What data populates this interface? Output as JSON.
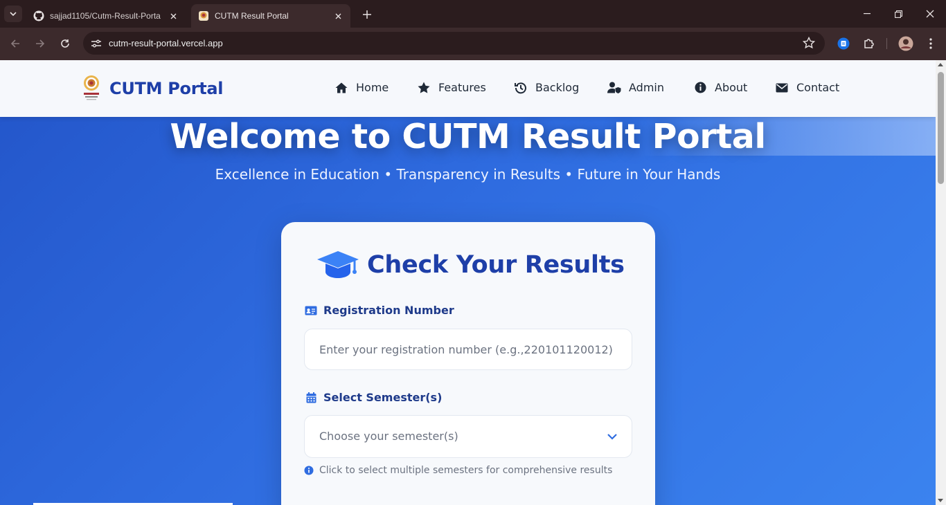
{
  "browser": {
    "tabs": [
      {
        "title": "sajjad1105/Cutm-Result-Portal",
        "icon": "github-icon",
        "active": false
      },
      {
        "title": "CUTM Result Portal",
        "icon": "cutm-favicon",
        "active": true
      }
    ],
    "url": "cutm-result-portal.vercel.app"
  },
  "nav": {
    "brand": "CUTM Portal",
    "links": [
      {
        "label": "Home",
        "icon": "home-icon"
      },
      {
        "label": "Features",
        "icon": "star-icon"
      },
      {
        "label": "Backlog",
        "icon": "history-icon"
      },
      {
        "label": "Admin",
        "icon": "user-shield-icon"
      },
      {
        "label": "About",
        "icon": "info-circle-icon"
      },
      {
        "label": "Contact",
        "icon": "envelope-icon"
      }
    ]
  },
  "hero": {
    "title": "Welcome to CUTM Result Portal",
    "subtitle": "Excellence in Education • Transparency in Results • Future in Your Hands"
  },
  "form": {
    "title": "Check Your Results",
    "registration": {
      "label": "Registration Number",
      "placeholder": "Enter your registration number (e.g.,220101120012)",
      "value": ""
    },
    "semester": {
      "label": "Select Semester(s)",
      "placeholder": "Choose your semester(s)",
      "hint": "Click to select multiple semesters for comprehensive results"
    }
  },
  "colors": {
    "brand": "#1e3fa8",
    "accent": "#2f6ce0",
    "chrome": "#3c2a2c"
  }
}
